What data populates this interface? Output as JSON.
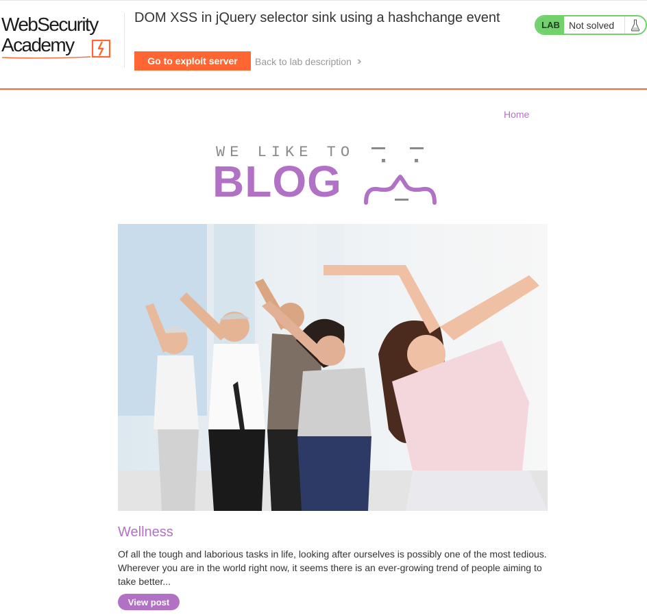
{
  "academy": {
    "logo_line1": "WebSecurity",
    "logo_line2": "Academy",
    "lab_title": "DOM XSS in jQuery selector sink using a hashchange event",
    "exploit_button": "Go to exploit server",
    "back_link": "Back to lab description",
    "lab_badge": "LAB",
    "lab_status": "Not solved",
    "brand_color": "#ff6633",
    "status_color": "#70d16d"
  },
  "blog": {
    "nav_home": "Home",
    "tagline": "WE LIKE TO",
    "logo_word": "BLOG",
    "accent_color": "#b172c5",
    "post": {
      "title": "Wellness",
      "excerpt": "Of all the tough and laborious tasks in life, looking after ourselves is possibly one of the most tedious. Wherever you are in the world right now, it seems there is an ever-growing trend of people aiming to take better...",
      "button": "View post",
      "image_icon": "fitness-class-photo"
    }
  }
}
